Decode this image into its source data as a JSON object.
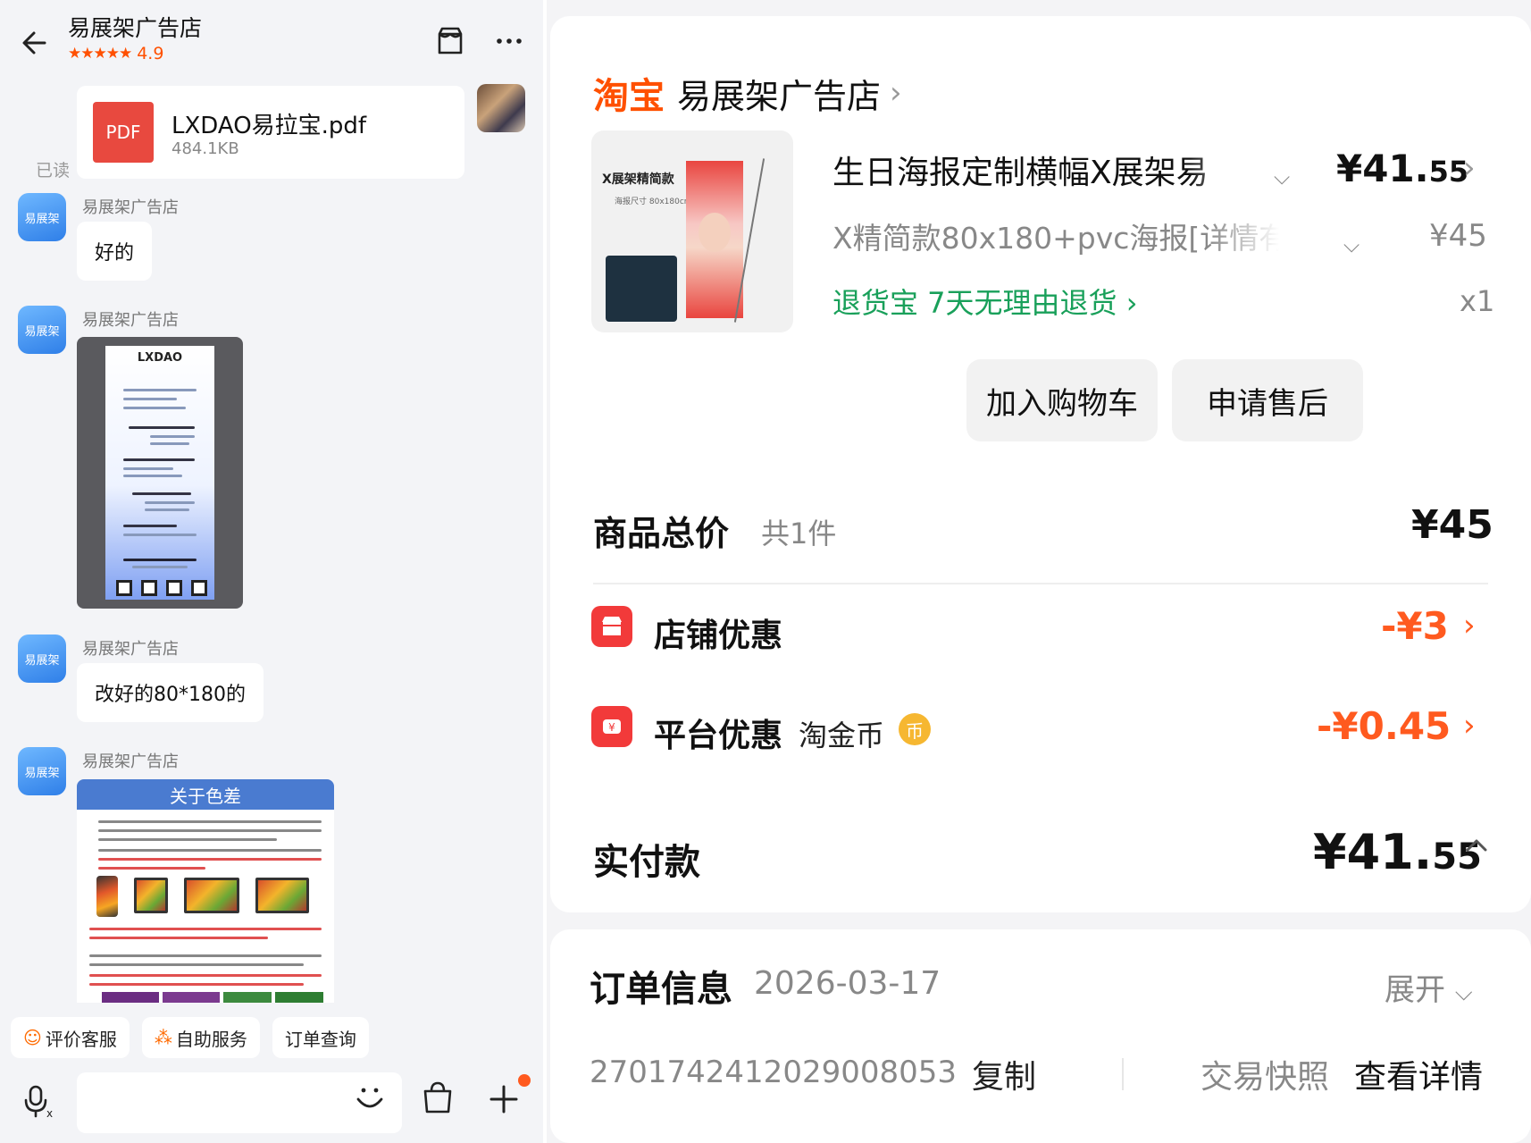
{
  "chat": {
    "header": {
      "shop_name": "易展架广告店",
      "stars": "★★★★★",
      "rating": "4.9"
    },
    "file_message": {
      "icon_label": "PDF",
      "file_name": "LXDAO易拉宝.pdf",
      "file_size": "484.1KB",
      "read_status": "已读"
    },
    "messages": [
      {
        "sender": "易展架广告店",
        "avatar_text": "易展架",
        "text": "好的"
      },
      {
        "sender": "易展架广告店",
        "avatar_text": "易展架",
        "image_logo": "LXDAO"
      },
      {
        "sender": "易展架广告店",
        "avatar_text": "易展架",
        "text": "改好的80*180的"
      },
      {
        "sender": "易展架广告店",
        "avatar_text": "易展架",
        "image_title": "关于色差"
      }
    ],
    "quick_actions": [
      {
        "icon": "smiley-icon",
        "label": "评价客服"
      },
      {
        "icon": "grid-icon",
        "label": "自助服务"
      },
      {
        "label": "订单查询"
      }
    ]
  },
  "order": {
    "platform_logo": "淘宝",
    "shop_name": "易展架广告店",
    "product": {
      "image_title": "X展架精简款",
      "image_sub": "海报尺寸 80x180cm",
      "title": "生日海报定制横幅X展架易",
      "price_main": "¥41.",
      "price_cents": "55",
      "sku": "X精简款80x180+pvc海报[详情有",
      "original_price": "¥45",
      "return_policy": "退货宝  7天无理由退货",
      "quantity": "x1"
    },
    "buttons": {
      "add_to_cart": "加入购物车",
      "after_sales": "申请售后"
    },
    "summary": {
      "label": "商品总价",
      "count": "共1件",
      "price": "¥45"
    },
    "discounts": [
      {
        "label": "店铺优惠",
        "value": "-¥3"
      },
      {
        "label": "平台优惠",
        "sub": "淘金币",
        "value": "-¥0.45"
      }
    ],
    "paid": {
      "label": "实付款",
      "price_main": "¥41.",
      "price_cents": "55"
    },
    "info": {
      "title": "订单信息",
      "date": "2026-03-17",
      "expand_label": "展开",
      "order_number": "2701742412029008053",
      "copy_label": "复制",
      "snapshot_label": "交易快照",
      "view_detail_label": "查看详情"
    }
  },
  "colors": {
    "taobao_orange": "#ff5000",
    "discount_red": "#f23a3a",
    "discount_value": "#ff5a1f",
    "return_green": "#19a05a",
    "shop_avatar_blue": "#2f7fe8"
  }
}
